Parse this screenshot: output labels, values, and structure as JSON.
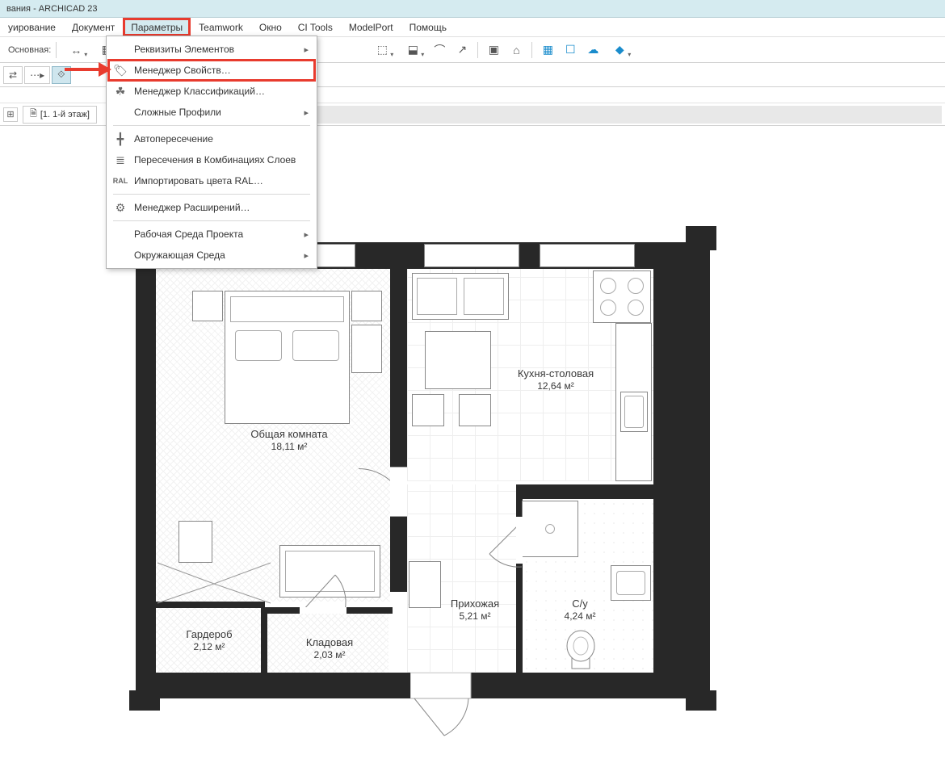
{
  "title_bar": {
    "text": "вания - ARCHICAD 23"
  },
  "menu": {
    "items": [
      "уирование",
      "Документ",
      "Параметры",
      "Teamwork",
      "Окно",
      "CI Tools",
      "ModelPort",
      "Помощь"
    ],
    "highlighted_index": 2
  },
  "toolbar": {
    "left_label": "Основная:"
  },
  "tabs": {
    "active": "[1. 1-й этаж]"
  },
  "dropdown": {
    "items": [
      {
        "label": "Реквизиты Элементов",
        "icon": "",
        "submenu": true
      },
      {
        "label": "Менеджер Свойств…",
        "icon": "tag-icon",
        "highlighted": true
      },
      {
        "label": "Менеджер Классификаций…",
        "icon": "tree-icon"
      },
      {
        "label": "Сложные Профили",
        "icon": "",
        "submenu": true
      },
      {
        "sep": true
      },
      {
        "label": "Автопересечение",
        "icon": "intersect-icon"
      },
      {
        "label": "Пересечения в Комбинациях Слоев",
        "icon": "layers-icon"
      },
      {
        "label": "Импортировать цвета RAL…",
        "icon": "ral-icon"
      },
      {
        "sep": true
      },
      {
        "label": "Менеджер Расширений…",
        "icon": "plugin-icon"
      },
      {
        "sep": true
      },
      {
        "label": "Рабочая Среда Проекта",
        "icon": "",
        "submenu": true
      },
      {
        "label": "Окружающая Среда",
        "icon": "",
        "submenu": true
      }
    ]
  },
  "rooms": {
    "living": {
      "name": "Общая комната",
      "area": "18,11 м²"
    },
    "kitchen": {
      "name": "Кухня-столовая",
      "area": "12,64 м²"
    },
    "wc": {
      "name": "С/у",
      "area": "4,24 м²"
    },
    "hall": {
      "name": "Прихожая",
      "area": "5,21 м²"
    },
    "wardrobe": {
      "name": "Гардероб",
      "area": "2,12 м²"
    },
    "storage": {
      "name": "Кладовая",
      "area": "2,03 м²"
    }
  }
}
